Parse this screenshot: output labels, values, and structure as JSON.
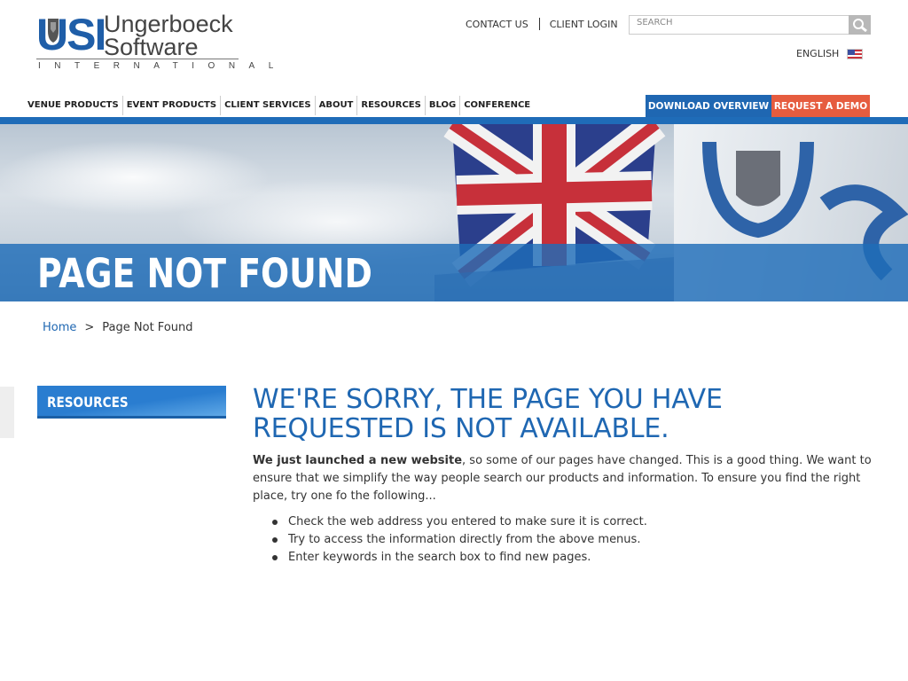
{
  "header": {
    "logo": {
      "mark": "USI",
      "name_line1": "Ungerboeck",
      "name_line2": "Software",
      "tagline": "INTERNATIONAL"
    },
    "top_links": {
      "contact": "CONTACT US",
      "login": "CLIENT LOGIN"
    },
    "search": {
      "placeholder": "SEARCH"
    },
    "language": "ENGLISH"
  },
  "nav": {
    "items": [
      {
        "label": "VENUE PRODUCTS"
      },
      {
        "label": "EVENT PRODUCTS"
      },
      {
        "label": "CLIENT SERVICES"
      },
      {
        "label": "ABOUT"
      },
      {
        "label": "RESOURCES"
      },
      {
        "label": "BLOG"
      },
      {
        "label": "CONFERENCE"
      }
    ],
    "download_label": "DOWNLOAD OVERVIEW",
    "demo_label": "REQUEST A DEMO"
  },
  "hero": {
    "title": "PAGE NOT FOUND"
  },
  "breadcrumb": {
    "home": "Home",
    "separator": ">",
    "current": "Page Not Found"
  },
  "sidebar": {
    "heading": "RESOURCES"
  },
  "main": {
    "heading": "WE'RE SORRY, THE PAGE YOU HAVE REQUESTED IS NOT AVAILABLE.",
    "intro_bold": "We just launched a new website",
    "intro_rest": ", so some of our pages have changed. This is a good thing. We want to ensure that we simplify the way people search our products and information. To ensure you find the right place, try one fo the following...",
    "tips": [
      "Check the web address you entered to make sure it is correct.",
      "Try to access the information directly from the above menus.",
      "Enter keywords in the search box to find new pages."
    ]
  },
  "colors": {
    "brand_blue": "#1f67b2",
    "demo_orange": "#e65c3f",
    "nav_bar": "#1f6cb8"
  }
}
